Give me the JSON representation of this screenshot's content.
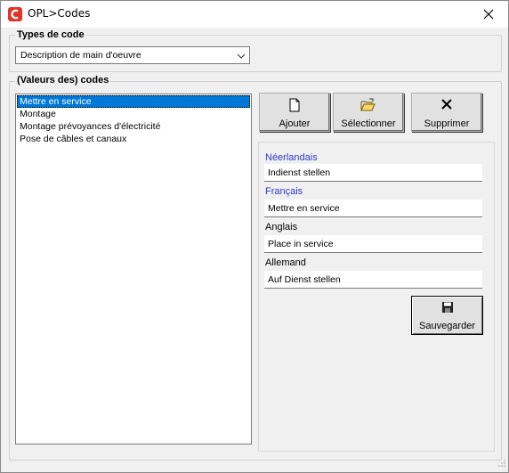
{
  "window": {
    "title": "OPL>Codes",
    "app_icon_letter": "C",
    "close_glyph": "✕"
  },
  "types_group": {
    "title": "Types de code",
    "selected": "Description de main d'oeuvre"
  },
  "codes_group": {
    "title": "(Valeurs des) codes",
    "items": [
      "Mettre en service",
      "Montage",
      "Montage prévoyances d'électricité",
      "Pose de câbles et canaux"
    ],
    "selected_index": 0
  },
  "toolbar": {
    "add_label": "Ajouter",
    "select_label": "Sélectionner",
    "delete_label": "Supprimer"
  },
  "translations": {
    "nl_label": "Néerlandais",
    "nl_value": "Indienst stellen",
    "fr_label": "Français",
    "fr_value": "Mettre en service",
    "en_label": "Anglais",
    "en_value": "Place in service",
    "de_label": "Allemand",
    "de_value": "Auf Dienst stellen"
  },
  "save_label": "Sauvegarder",
  "colors": {
    "accent": "#e4332a",
    "selection": "#0078d7",
    "label_blue": "#2b3aca"
  }
}
